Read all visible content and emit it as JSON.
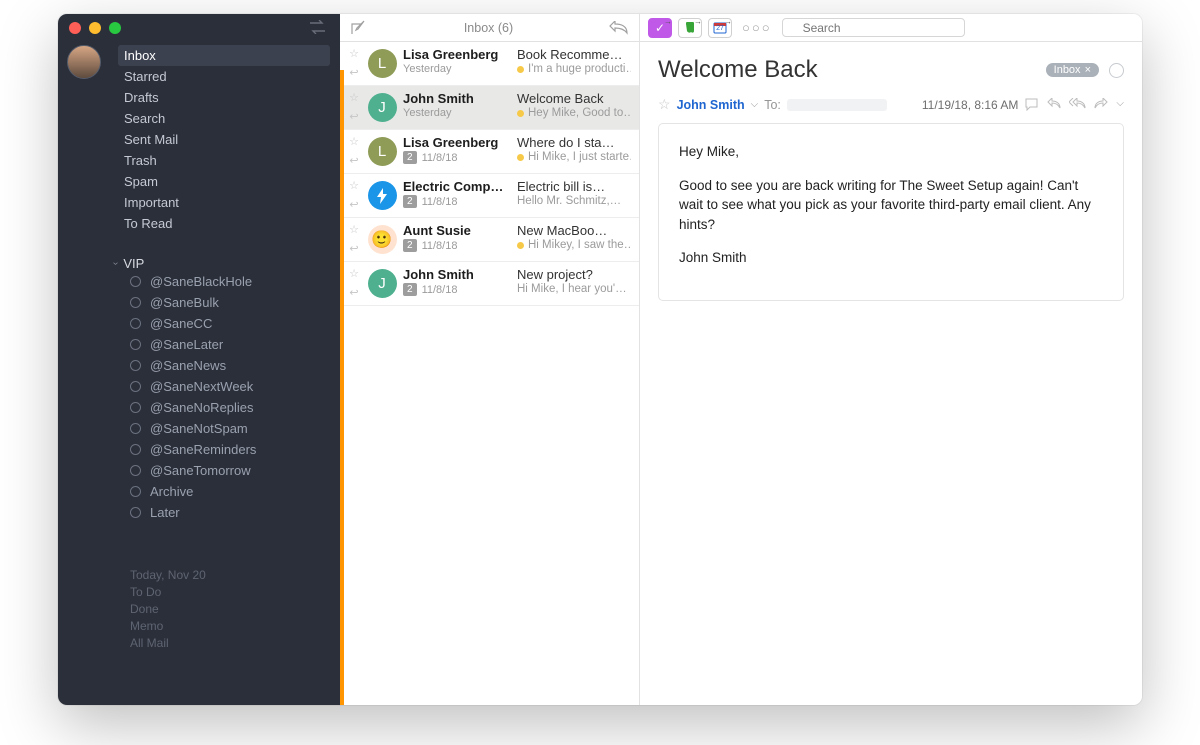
{
  "sidebar": {
    "folders": [
      "Inbox",
      "Starred",
      "Drafts",
      "Search",
      "Sent Mail",
      "Trash",
      "Spam",
      "Important",
      "To Read"
    ],
    "selected": "Inbox",
    "vip_label": "VIP",
    "sane": [
      "@SaneBlackHole",
      "@SaneBulk",
      "@SaneCC",
      "@SaneLater",
      "@SaneNews",
      "@SaneNextWeek",
      "@SaneNoReplies",
      "@SaneNotSpam",
      "@SaneReminders",
      "@SaneTomorrow",
      "Archive",
      "Later"
    ],
    "footnotes": [
      "Today, Nov 20",
      "To Do",
      "Done",
      "Memo",
      "All Mail"
    ]
  },
  "list": {
    "title": "Inbox (6)",
    "items": [
      {
        "avatar": "L",
        "sender": "Lisa Greenberg",
        "date": "Yesterday",
        "count": null,
        "subject": "Book Recomme…",
        "preview": "I'm a huge producti…",
        "dot": true
      },
      {
        "avatar": "J",
        "sender": "John Smith",
        "date": "Yesterday",
        "count": null,
        "subject": "Welcome Back",
        "preview": "Hey Mike, Good to…",
        "dot": true,
        "selected": true
      },
      {
        "avatar": "L",
        "sender": "Lisa Greenberg",
        "date": "11/8/18",
        "count": "2",
        "subject": "Where do I sta…",
        "preview": "Hi Mike, I just starte…",
        "dot": true
      },
      {
        "avatar": "bolt",
        "sender": "Electric Comp…",
        "date": "11/8/18",
        "count": "2",
        "subject": "Electric bill is…",
        "preview": "Hello Mr. Schmitz,…",
        "dot": false
      },
      {
        "avatar": "face",
        "sender": "Aunt Susie",
        "date": "11/8/18",
        "count": "2",
        "subject": "New MacBoo…",
        "preview": "Hi Mikey, I saw the…",
        "dot": true
      },
      {
        "avatar": "J",
        "sender": "John Smith",
        "date": "11/8/18",
        "count": "2",
        "subject": "New project?",
        "preview": "Hi Mike, I hear you'…",
        "dot": false
      }
    ]
  },
  "toolbar": {
    "cal_text": "27",
    "search_placeholder": "Search"
  },
  "message": {
    "title": "Welcome Back",
    "pill": "Inbox",
    "from": "John Smith",
    "to_label": "To:",
    "timestamp": "11/19/18, 8:16 AM",
    "body": [
      "Hey Mike,",
      "Good to see you are back writing for The Sweet Setup again! Can't wait to see what you pick as your favorite third-party email client. Any hints?",
      "John Smith"
    ]
  }
}
